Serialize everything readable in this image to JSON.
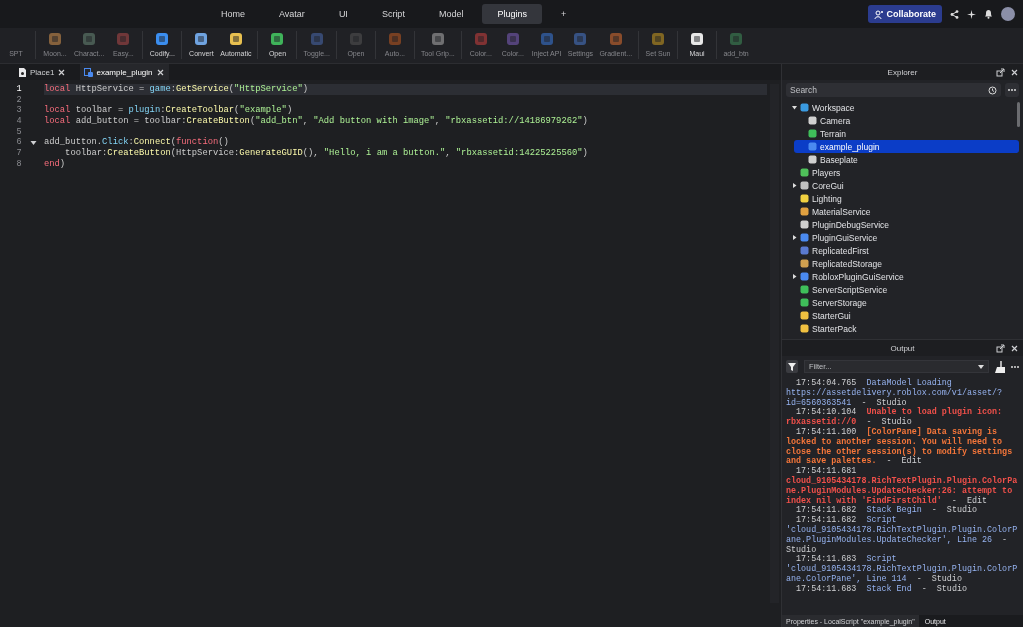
{
  "menu_tabs": [
    {
      "label": "Home",
      "selected": false
    },
    {
      "label": "Avatar",
      "selected": false
    },
    {
      "label": "UI",
      "selected": false
    },
    {
      "label": "Script",
      "selected": false
    },
    {
      "label": "Model",
      "selected": false
    },
    {
      "label": "Plugins",
      "selected": true
    },
    {
      "label": "+",
      "selected": false
    }
  ],
  "collaborate_button": "Collaborate",
  "toolbar": [
    {
      "label": "SPT",
      "disabled": true,
      "group_start": false
    },
    {
      "label": "Moon...",
      "disabled": true,
      "group_start": true
    },
    {
      "label": "Charact...",
      "disabled": true,
      "group_start": false
    },
    {
      "label": "Easy...",
      "disabled": true,
      "group_start": false
    },
    {
      "label": "Codify...",
      "disabled": false,
      "group_start": true
    },
    {
      "label": "Convert",
      "disabled": false,
      "group_start": true
    },
    {
      "label": "Automatic",
      "disabled": false,
      "group_start": false
    },
    {
      "label": "Open",
      "disabled": false,
      "group_start": true
    },
    {
      "label": "Toggle...",
      "disabled": true,
      "group_start": true
    },
    {
      "label": "Open",
      "disabled": true,
      "group_start": true
    },
    {
      "label": "Auto...",
      "disabled": true,
      "group_start": true
    },
    {
      "label": "Tool Grip...",
      "disabled": true,
      "group_start": true
    },
    {
      "label": "Color...",
      "disabled": true,
      "group_start": true
    },
    {
      "label": "Color...",
      "disabled": true,
      "group_start": false
    },
    {
      "label": "Inject API",
      "disabled": true,
      "group_start": false
    },
    {
      "label": "Settings",
      "disabled": true,
      "group_start": false
    },
    {
      "label": "Gradient...",
      "disabled": true,
      "group_start": false
    },
    {
      "label": "Set Sun",
      "disabled": true,
      "group_start": true
    },
    {
      "label": "Maui",
      "disabled": false,
      "group_start": true
    },
    {
      "label": "add_btn",
      "disabled": true,
      "group_start": true
    }
  ],
  "editor_tabs": [
    {
      "label": "Place1",
      "selected": false
    },
    {
      "label": "example_plugin",
      "selected": true
    }
  ],
  "code": {
    "lines": [
      {
        "number": "1",
        "current": true,
        "tokens": [
          {
            "kind": "kw",
            "text": "local"
          },
          {
            "kind": "plain",
            "text": " HttpService = "
          },
          {
            "kind": "builtin",
            "text": "game"
          },
          {
            "kind": "plain",
            "text": ":"
          },
          {
            "kind": "method",
            "text": "GetService"
          },
          {
            "kind": "plain",
            "text": "("
          },
          {
            "kind": "str",
            "text": "\"HttpService\""
          },
          {
            "kind": "plain",
            "text": ")"
          }
        ]
      },
      {
        "number": "2",
        "current": false
      },
      {
        "number": "3",
        "current": false,
        "tokens": [
          {
            "kind": "kw",
            "text": "local"
          },
          {
            "kind": "plain",
            "text": " toolbar = "
          },
          {
            "kind": "builtin",
            "text": "plugin"
          },
          {
            "kind": "plain",
            "text": ":"
          },
          {
            "kind": "method",
            "text": "CreateToolbar"
          },
          {
            "kind": "plain",
            "text": "("
          },
          {
            "kind": "str",
            "text": "\"example\""
          },
          {
            "kind": "plain",
            "text": ")"
          }
        ]
      },
      {
        "number": "4",
        "current": false,
        "tokens": [
          {
            "kind": "kw",
            "text": "local"
          },
          {
            "kind": "plain",
            "text": " add_button = toolbar:"
          },
          {
            "kind": "method",
            "text": "CreateButton"
          },
          {
            "kind": "plain",
            "text": "("
          },
          {
            "kind": "str",
            "text": "\"add_btn\""
          },
          {
            "kind": "plain",
            "text": ", "
          },
          {
            "kind": "str",
            "text": "\"Add button with image\""
          },
          {
            "kind": "plain",
            "text": ", "
          },
          {
            "kind": "str",
            "text": "\"rbxassetid://14186979262\""
          },
          {
            "kind": "plain",
            "text": ")"
          }
        ]
      },
      {
        "number": "5",
        "current": false
      },
      {
        "number": "6",
        "current": false,
        "foldable": true,
        "tokens": [
          {
            "kind": "plain",
            "text": "add_button."
          },
          {
            "kind": "builtin",
            "text": "Click"
          },
          {
            "kind": "plain",
            "text": ":"
          },
          {
            "kind": "method",
            "text": "Connect"
          },
          {
            "kind": "plain",
            "text": "("
          },
          {
            "kind": "kw",
            "text": "function"
          },
          {
            "kind": "plain",
            "text": "()"
          }
        ]
      },
      {
        "number": "7",
        "current": false,
        "tokens": [
          {
            "kind": "plain",
            "text": "    toolbar:"
          },
          {
            "kind": "method",
            "text": "CreateButton"
          },
          {
            "kind": "plain",
            "text": "(HttpService:"
          },
          {
            "kind": "method",
            "text": "GenerateGUID"
          },
          {
            "kind": "plain",
            "text": "(), "
          },
          {
            "kind": "str",
            "text": "\"Hello, i am a button.\""
          },
          {
            "kind": "plain",
            "text": ", "
          },
          {
            "kind": "str",
            "text": "\"rbxassetid:14225225560\""
          },
          {
            "kind": "plain",
            "text": ")"
          }
        ]
      },
      {
        "number": "8",
        "current": false,
        "tokens": [
          {
            "kind": "kw",
            "text": "end"
          },
          {
            "kind": "plain",
            "text": ")"
          }
        ]
      }
    ]
  },
  "explorer": {
    "title": "Explorer",
    "search": {
      "placeholder": "Search"
    },
    "items": [
      {
        "label": "Workspace",
        "selected": false,
        "expanded": true,
        "children": [
          {
            "label": "Camera",
            "selected": false
          },
          {
            "label": "Terrain",
            "selected": false
          },
          {
            "label": "example_plugin",
            "selected": true
          },
          {
            "label": "Baseplate",
            "selected": false
          }
        ]
      },
      {
        "label": "Players",
        "selected": false
      },
      {
        "label": "CoreGui",
        "selected": false,
        "expanded": false
      },
      {
        "label": "Lighting",
        "selected": false
      },
      {
        "label": "MaterialService",
        "selected": false
      },
      {
        "label": "PluginDebugService",
        "selected": false
      },
      {
        "label": "PluginGuiService",
        "selected": false,
        "expanded": false
      },
      {
        "label": "ReplicatedFirst",
        "selected": false
      },
      {
        "label": "ReplicatedStorage",
        "selected": false
      },
      {
        "label": "RobloxPluginGuiService",
        "selected": false,
        "expanded": false
      },
      {
        "label": "ServerScriptService",
        "selected": false
      },
      {
        "label": "ServerStorage",
        "selected": false
      },
      {
        "label": "StarterGui",
        "selected": false
      },
      {
        "label": "StarterPack",
        "selected": false
      }
    ]
  },
  "output": {
    "title": "Output",
    "filter": {
      "placeholder": "Filter..."
    },
    "entries": [
      {
        "kind": "info",
        "time": "17:54:04.765",
        "message": "DataModel Loading https://assetdelivery.roblox.com/v1/asset/?id=6560363541",
        "source": "-  Studio"
      },
      {
        "kind": "error",
        "time": "17:54:10.104",
        "message": "Unable to load plugin icon: rbxassetid://0",
        "source": "-  Studio"
      },
      {
        "kind": "warning",
        "time": "17:54:11.100",
        "message": "[ColorPane] Data saving is locked to another session. You will need to close the other session(s) to modify settings and save palettes.",
        "source": "-  Edit"
      },
      {
        "kind": "error",
        "time": "17:54:11.681",
        "message": "cloud_9105434178.RichTextPlugin.Plugin.ColorPane.PluginModules.UpdateChecker:26: attempt to index nil with 'FindFirstChild'",
        "source": "-  Edit"
      },
      {
        "kind": "info",
        "time": "17:54:11.682",
        "message": "Stack Begin",
        "source": "-  Studio"
      },
      {
        "kind": "info",
        "time": "17:54:11.682",
        "message": "Script 'cloud_9105434178.RichTextPlugin.Plugin.ColorPane.PluginModules.UpdateChecker', Line 26",
        "source": "-  Studio"
      },
      {
        "kind": "info",
        "time": "17:54:11.683",
        "message": "Script 'cloud_9105434178.RichTextPlugin.Plugin.ColorPane.ColorPane', Line 114",
        "source": "-  Studio"
      },
      {
        "kind": "info",
        "time": "17:54:11.683",
        "message": "Stack End",
        "source": "-  Studio"
      }
    ]
  },
  "bottom_tabs": [
    {
      "label": "Properties - LocalScript \"example_plugin\"",
      "selected": false
    },
    {
      "label": "Output",
      "selected": true
    }
  ]
}
